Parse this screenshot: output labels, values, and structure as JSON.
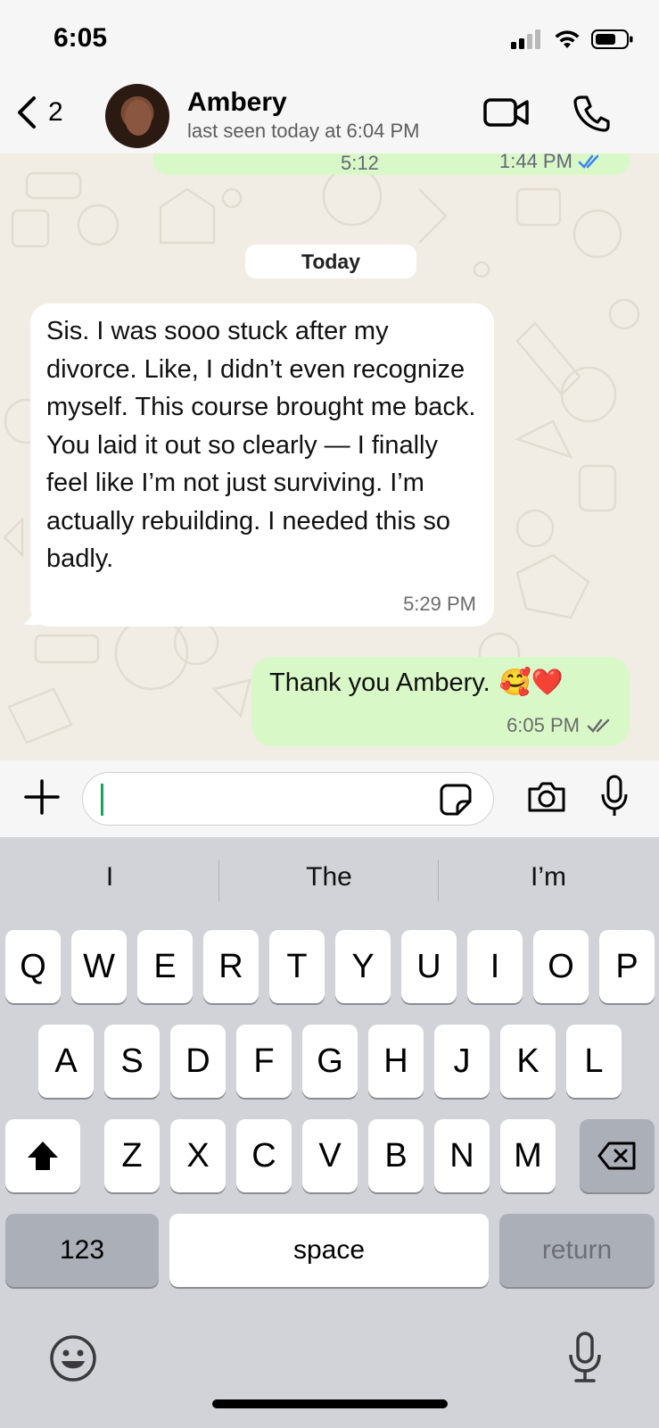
{
  "status_bar": {
    "time": "6:05"
  },
  "header": {
    "back_count": "2",
    "contact_name": "Ambery",
    "last_seen": "last seen today at 6:04 PM"
  },
  "chat": {
    "previous": {
      "duration": "5:12",
      "time": "1:44 PM"
    },
    "date_label": "Today",
    "messages": [
      {
        "direction": "incoming",
        "text": "Sis. I was sooo stuck after my divorce. Like, I didn’t even recognize myself. This course brought me back. You laid it out so clearly — I finally feel like I’m not just surviving. I’m actually rebuilding. I needed this so badly.",
        "time": "5:29 PM"
      },
      {
        "direction": "outgoing",
        "text": "Thank you Ambery.",
        "emoji": "🥰❤️",
        "time": "6:05 PM"
      }
    ]
  },
  "input": {
    "placeholder": ""
  },
  "keyboard": {
    "suggestions": [
      "I",
      "The",
      "I’m"
    ],
    "row1": [
      "Q",
      "W",
      "E",
      "R",
      "T",
      "Y",
      "U",
      "I",
      "O",
      "P"
    ],
    "row2": [
      "A",
      "S",
      "D",
      "F",
      "G",
      "H",
      "J",
      "K",
      "L"
    ],
    "row3": [
      "Z",
      "X",
      "C",
      "V",
      "B",
      "N",
      "M"
    ],
    "numbers_label": "123",
    "space_label": "space",
    "return_label": "return"
  },
  "colors": {
    "outgoing_bubble": "#d9f8c8",
    "incoming_bubble": "#ffffff",
    "read_tick": "#3b82f6",
    "caret": "#1aa35d"
  }
}
